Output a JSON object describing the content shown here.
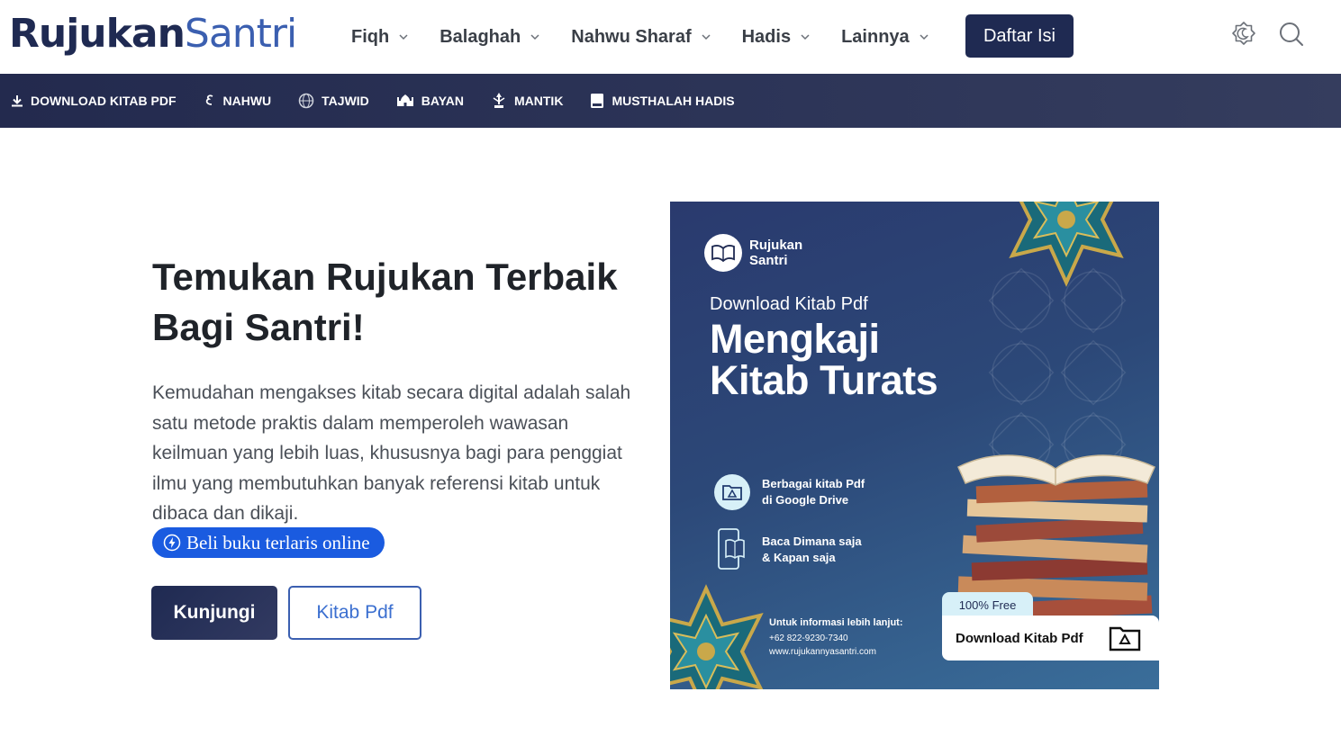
{
  "header": {
    "logo_part1": "Rujukan",
    "logo_part2": "Santri",
    "nav": [
      {
        "label": "Fiqh"
      },
      {
        "label": "Balaghah"
      },
      {
        "label": "Nahwu Sharaf"
      },
      {
        "label": "Hadis"
      },
      {
        "label": "Lainnya"
      }
    ],
    "cta_label": "Daftar Isi",
    "icons": [
      "theme-toggle-icon",
      "search-icon"
    ]
  },
  "subnav": {
    "items": [
      {
        "label": "DOWNLOAD KITAB PDF",
        "icon": "download-icon"
      },
      {
        "label": "NAHWU",
        "icon": "arabic-letter-icon"
      },
      {
        "label": "TAJWID",
        "icon": "globe-icon"
      },
      {
        "label": "BAYAN",
        "icon": "mosque-icon"
      },
      {
        "label": "MANTIK",
        "icon": "lamp-icon"
      },
      {
        "label": "MUSTHALAH HADIS",
        "icon": "book-icon"
      }
    ]
  },
  "hero": {
    "title": "Temukan Rujukan Terbaik Bagi Santri!",
    "text": "Kemudahan mengakses kitab secara digital adalah salah satu metode praktis dalam memperoleh wawasan keilmuan yang lebih luas, khususnya bagi para penggiat ilmu yang membutuhkan banyak referensi kitab untuk dibaca dan dikaji.",
    "pill_label": "Beli buku terlaris online",
    "primary_button": "Kunjungi",
    "secondary_button": "Kitab Pdf"
  },
  "banner": {
    "logo_line1": "Rujukan",
    "logo_line2": "Santri",
    "subtitle": "Download Kitab Pdf",
    "title_line1": "Mengkaji",
    "title_line2": "Kitab Turats",
    "feature1_line1": "Berbagai kitab Pdf",
    "feature1_line2": "di Google Drive",
    "feature2_line1": "Baca Dimana saja",
    "feature2_line2": "& Kapan saja",
    "info_heading": "Untuk informasi lebih lanjut:",
    "info_phone": "+62 822-9230-7340",
    "info_web": "www.rujukannyasantri.com",
    "free_tag": "100% Free",
    "download_label": "Download Kitab Pdf"
  },
  "colors": {
    "brand_dark": "#1f2a52",
    "brand_blue": "#3b5fb0",
    "pill_blue": "#1a5be0",
    "subbar_bg": "#2a3154"
  }
}
